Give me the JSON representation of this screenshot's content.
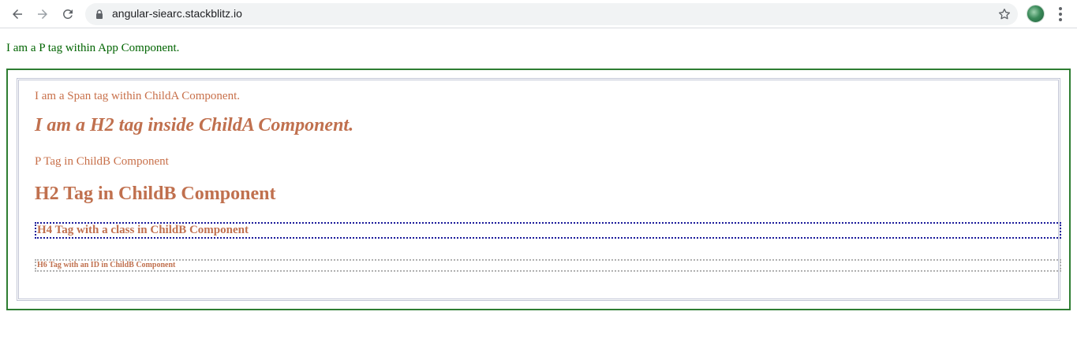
{
  "browser": {
    "url": "angular-siearc.stackblitz.io",
    "icons": {
      "back": "arrow-left-icon",
      "forward": "arrow-right-icon",
      "reload": "reload-icon",
      "lock": "lock-icon",
      "bookmark": "star-icon",
      "profile": "avatar-icon",
      "menu": "kebab-menu-icon"
    }
  },
  "app": {
    "p_text": "I am a P tag within App Component.",
    "childA": {
      "span_text": "I am a Span tag within ChildA Component.",
      "h2_text": "I am a H2 tag inside ChildA Component."
    },
    "childB": {
      "p_text": "P Tag in ChildB Component",
      "h2_text": "H2 Tag in ChildB Component",
      "h4_text": "H4 Tag with a class in ChildB Component",
      "h6_text": "H6 Tag with an ID in ChildB Component"
    }
  },
  "colors": {
    "app_text": "#006400",
    "app_border": "#2e7d32",
    "child_text": "#c0704e",
    "h4_border": "#1a1a9a",
    "h6_border": "#b0b0b0"
  }
}
